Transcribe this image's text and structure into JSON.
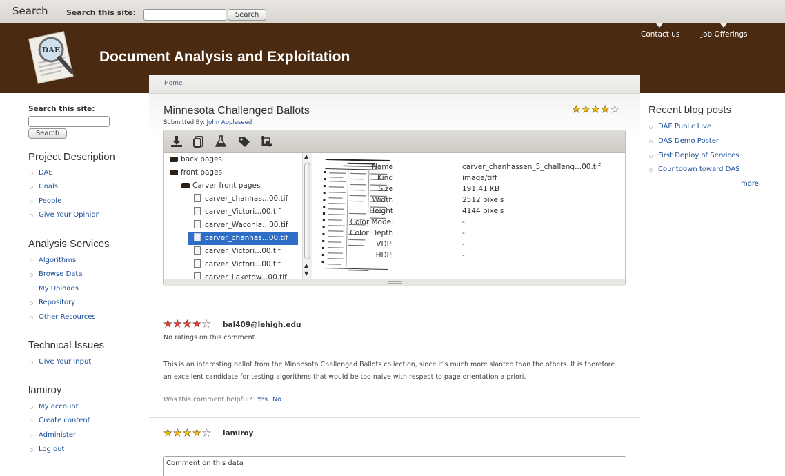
{
  "topbar": {
    "title": "Search",
    "label": "Search this site:",
    "input_value": "",
    "button": "Search"
  },
  "header": {
    "logo_text": "DAE",
    "site_title": "Document Analysis and Exploitation",
    "links": [
      "Contact us",
      "Job Offerings"
    ]
  },
  "breadcrumb": {
    "home": "Home"
  },
  "node": {
    "title": "Minnesota Challenged Ballots",
    "submitted_label": "Submitted By:",
    "author": "John Appleseed",
    "rating": 4
  },
  "browser": {
    "toolbar_icons": [
      "download-icon",
      "copy-icon",
      "flask-icon",
      "tag-icon",
      "crop-icon"
    ],
    "tree": [
      {
        "label": "back pages",
        "type": "folder",
        "depth": 0
      },
      {
        "label": "front pages",
        "type": "folder",
        "depth": 0
      },
      {
        "label": "Carver front pages",
        "type": "folder",
        "depth": 1
      },
      {
        "label": "carver_chanhas...00.tif",
        "type": "file",
        "depth": 2
      },
      {
        "label": "carver_Victori...00.tif",
        "type": "file",
        "depth": 2
      },
      {
        "label": "carver_Waconia...00.tif",
        "type": "file",
        "depth": 2
      },
      {
        "label": "carver_chanhas...00.tif",
        "type": "file",
        "depth": 2,
        "selected": true
      },
      {
        "label": "carver_Victori...00.tif",
        "type": "file",
        "depth": 2
      },
      {
        "label": "carver_Victori...00.tif",
        "type": "file",
        "depth": 2
      },
      {
        "label": "carver_Laketow...00.tif",
        "type": "file",
        "depth": 2
      }
    ],
    "properties": [
      {
        "key": "Name",
        "value": "carver_chanhassen_5_challeng...00.tif"
      },
      {
        "key": "Kind",
        "value": "image/tiff"
      },
      {
        "key": "Size",
        "value": "191.41 KB"
      },
      {
        "key": "Width",
        "value": "2512 pixels"
      },
      {
        "key": "Height",
        "value": "4144 pixels"
      },
      {
        "key": "Color Model",
        "value": "-"
      },
      {
        "key": "Color Depth",
        "value": "-"
      },
      {
        "key": "VDPI",
        "value": "-"
      },
      {
        "key": "HDPI",
        "value": "-"
      }
    ]
  },
  "comments": [
    {
      "user": "bal409@lehigh.edu",
      "rating": 4,
      "ratings_note": "No ratings on this comment.",
      "body": "This is an interesting ballot from the Minnesota Challenged Ballots collection, since it's much more slanted than the others. It is therefore an excellent candidate for testing algorithms that would be too naive with respect to page orientation a priori.",
      "helpful_label": "Was this comment helpful?",
      "yes": "Yes",
      "no": "No"
    },
    {
      "user": "lamiroy",
      "rating": 4
    }
  ],
  "comment_placeholder": "Comment on this data",
  "left_sidebar": {
    "search_label": "Search this site:",
    "search_button": "Search",
    "project": {
      "title": "Project Description",
      "items": [
        "DAE",
        "Goals",
        "People",
        "Give Your Opinion"
      ]
    },
    "analysis": {
      "title": "Analysis Services",
      "items": [
        "Algorithms",
        "Browse Data",
        "My Uploads",
        "Repository",
        "Other Resources"
      ]
    },
    "technical": {
      "title": "Technical Issues",
      "items": [
        "Give Your Input"
      ]
    },
    "user": {
      "title": "lamiroy",
      "items": [
        "My account",
        "Create content",
        "Administer",
        "Log out"
      ]
    }
  },
  "right_sidebar": {
    "title": "Recent blog posts",
    "items": [
      "DAE Public Live",
      "DAS Demo Poster",
      "First Deploy of Services",
      "Countdown toward DAS"
    ],
    "more": "more"
  },
  "colors": {
    "header_bg": "#4b2a12",
    "link": "#1e4f99",
    "selection": "#2f6ec6",
    "star_gold": "#f2c21b",
    "star_red": "#e0483d"
  }
}
